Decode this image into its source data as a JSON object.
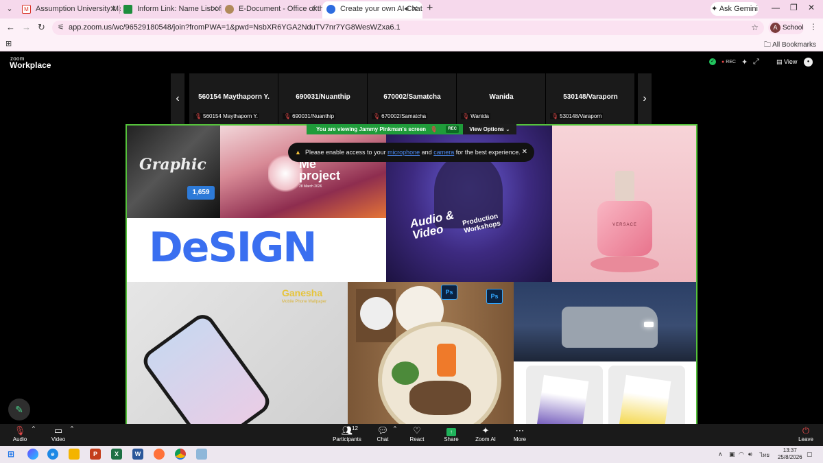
{
  "browser": {
    "tabs": [
      {
        "title": "Assumption University Mail",
        "favicon_color": "#d93025"
      },
      {
        "title": "Inform Link: Name List of Partic",
        "favicon_color": "#1e8e3e"
      },
      {
        "title": "E-Document - Office of the Vic",
        "favicon_color": "#b08a5a"
      },
      {
        "title": "Create your own AI Chatbo",
        "favicon_color": "#2d6cdf"
      }
    ],
    "ask_gemini": "Ask Gemini",
    "url": "app.zoom.us/wc/96529180548/join?fromPWA=1&pwd=NsbXR6YGA2NduTV7nr7YG8WesWZxa6.1",
    "profile_initial": "A",
    "profile_label": "School",
    "all_bookmarks": "All Bookmarks"
  },
  "zoom": {
    "logo_small": "zoom",
    "logo_large": "Workplace",
    "rec_label": "REC",
    "view_label": "View",
    "participants_strip": [
      {
        "name": "560154 Maythaporn Y.",
        "label": "560154 Maythaporn Y."
      },
      {
        "name": "690031/Nuanthip",
        "label": "690031/Nuanthip"
      },
      {
        "name": "670002/Samatcha",
        "label": "670002/Samatcha"
      },
      {
        "name": "Wanida",
        "label": "Wanida"
      },
      {
        "name": "530148/Varaporn",
        "label": "530148/Varaporn"
      }
    ],
    "viewing_banner": "You are viewing  Jammy Pinkman's screen",
    "banner_rec": "REC",
    "view_options": "View Options",
    "notice": {
      "prefix": "Please enable access to your",
      "link1": "microphone",
      "middle": "and",
      "link2": "camera",
      "suffix": "for the best experience."
    },
    "shared_content": {
      "graphic_word": "Graphic",
      "price": "1,659",
      "project_lines": [
        "Me",
        "project"
      ],
      "project_date": "28 March 2026",
      "design_word": "DeSIGN",
      "audio_lines": [
        "Audio &",
        "Video",
        "Production",
        "Workshops"
      ],
      "perfume_brand": "VERSACE",
      "ganesha_title": "Ganesha",
      "ganesha_sub": "Mobile Phone Wallpaper",
      "ps_label": "Ps"
    },
    "toolbar": {
      "audio": "Audio",
      "video": "Video",
      "participants": "Participants",
      "participants_count": "12",
      "chat": "Chat",
      "react": "React",
      "share": "Share",
      "zoom_ai": "Zoom AI",
      "more": "More",
      "leave": "Leave"
    }
  },
  "taskbar": {
    "time": "13:37",
    "date": "25/8/2026",
    "lang": "ไทย"
  },
  "colors": {
    "share_border": "#55c23b",
    "banner_green": "#1f9c3a",
    "mic_muted": "#e04848"
  }
}
